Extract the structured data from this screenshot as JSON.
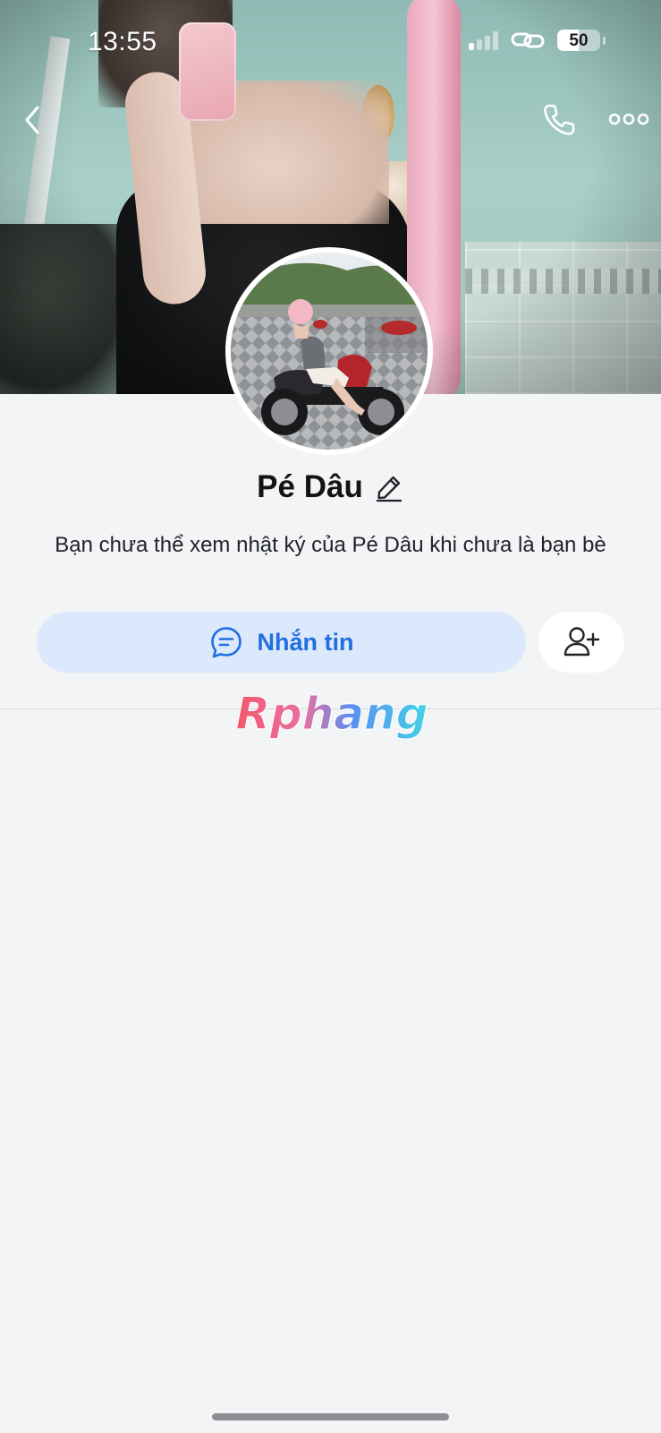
{
  "status_bar": {
    "time": "13:55",
    "battery_level": "50",
    "battery_fraction": 0.5,
    "signal_bars_active": 1,
    "signal_bars_total": 4
  },
  "nav": {
    "back_icon": "chevron-left-icon",
    "call_icon": "phone-icon",
    "more_icon": "more-horizontal-icon"
  },
  "profile": {
    "name": "Pé Dâu",
    "edit_icon": "pencil-icon",
    "privacy_note": "Bạn chưa thể xem nhật ký của Pé Dâu khi chưa là bạn bè"
  },
  "actions": {
    "message_label": "Nhắn tin",
    "message_icon": "chat-bubble-icon",
    "add_friend_icon": "add-user-icon"
  },
  "watermark": {
    "text": "Rphang"
  },
  "colors": {
    "accent_blue": "#1f6fe0",
    "message_button_bg": "#dce8fb",
    "page_bg": "#f3f4f6"
  }
}
